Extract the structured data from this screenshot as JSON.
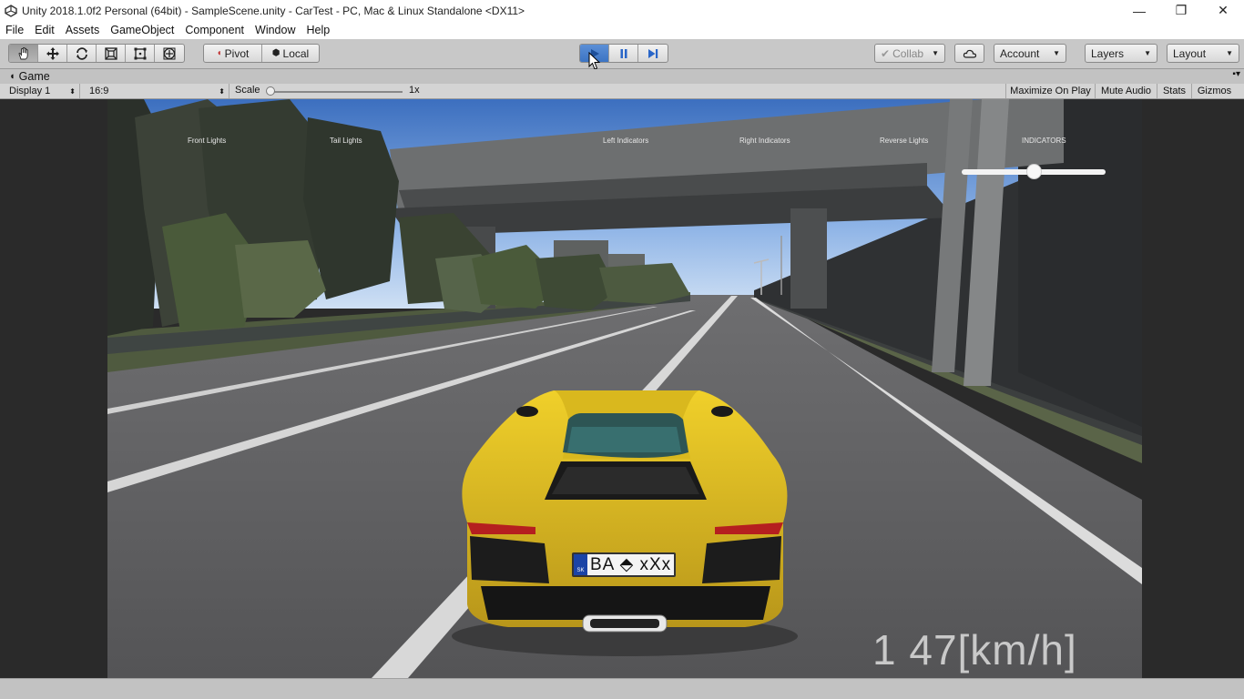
{
  "window": {
    "title": "Unity 2018.1.0f2 Personal (64bit) - SampleScene.unity - CarTest - PC, Mac & Linux Standalone <DX11>",
    "minimize": "—",
    "maximize": "❐",
    "close": "✕"
  },
  "menu": [
    "File",
    "Edit",
    "Assets",
    "GameObject",
    "Component",
    "Window",
    "Help"
  ],
  "toolbar": {
    "tools": [
      "hand-icon",
      "move-icon",
      "rotate-icon",
      "scale-icon",
      "rect-icon",
      "transform-icon"
    ],
    "pivot_label": "Pivot",
    "local_label": "Local",
    "collab_label": "Collab",
    "account_label": "Account",
    "layers_label": "Layers",
    "layout_label": "Layout",
    "play_state": "playing"
  },
  "game_tab": {
    "label": "Game"
  },
  "game_bar": {
    "display": "Display 1",
    "aspect": "16:9",
    "scale_label": "Scale",
    "scale_value": "1x",
    "maximize_on_play": "Maximize On Play",
    "mute_audio": "Mute Audio",
    "stats": "Stats",
    "gizmos": "Gizmos"
  },
  "hud": {
    "front_lights": "Front Lights",
    "tail_lights": "Tail Lights",
    "left_indicators": "Left Indicators",
    "right_indicators": "Right Indicators",
    "reverse_lights": "Reverse Lights",
    "indicators": "INDICATORS",
    "indicators_slider_value": 0.5,
    "speed": "1  47[km/h]"
  },
  "car": {
    "plate": "BA ⬘ xXx",
    "plate_country": "SK",
    "color": "#e8c21c"
  }
}
